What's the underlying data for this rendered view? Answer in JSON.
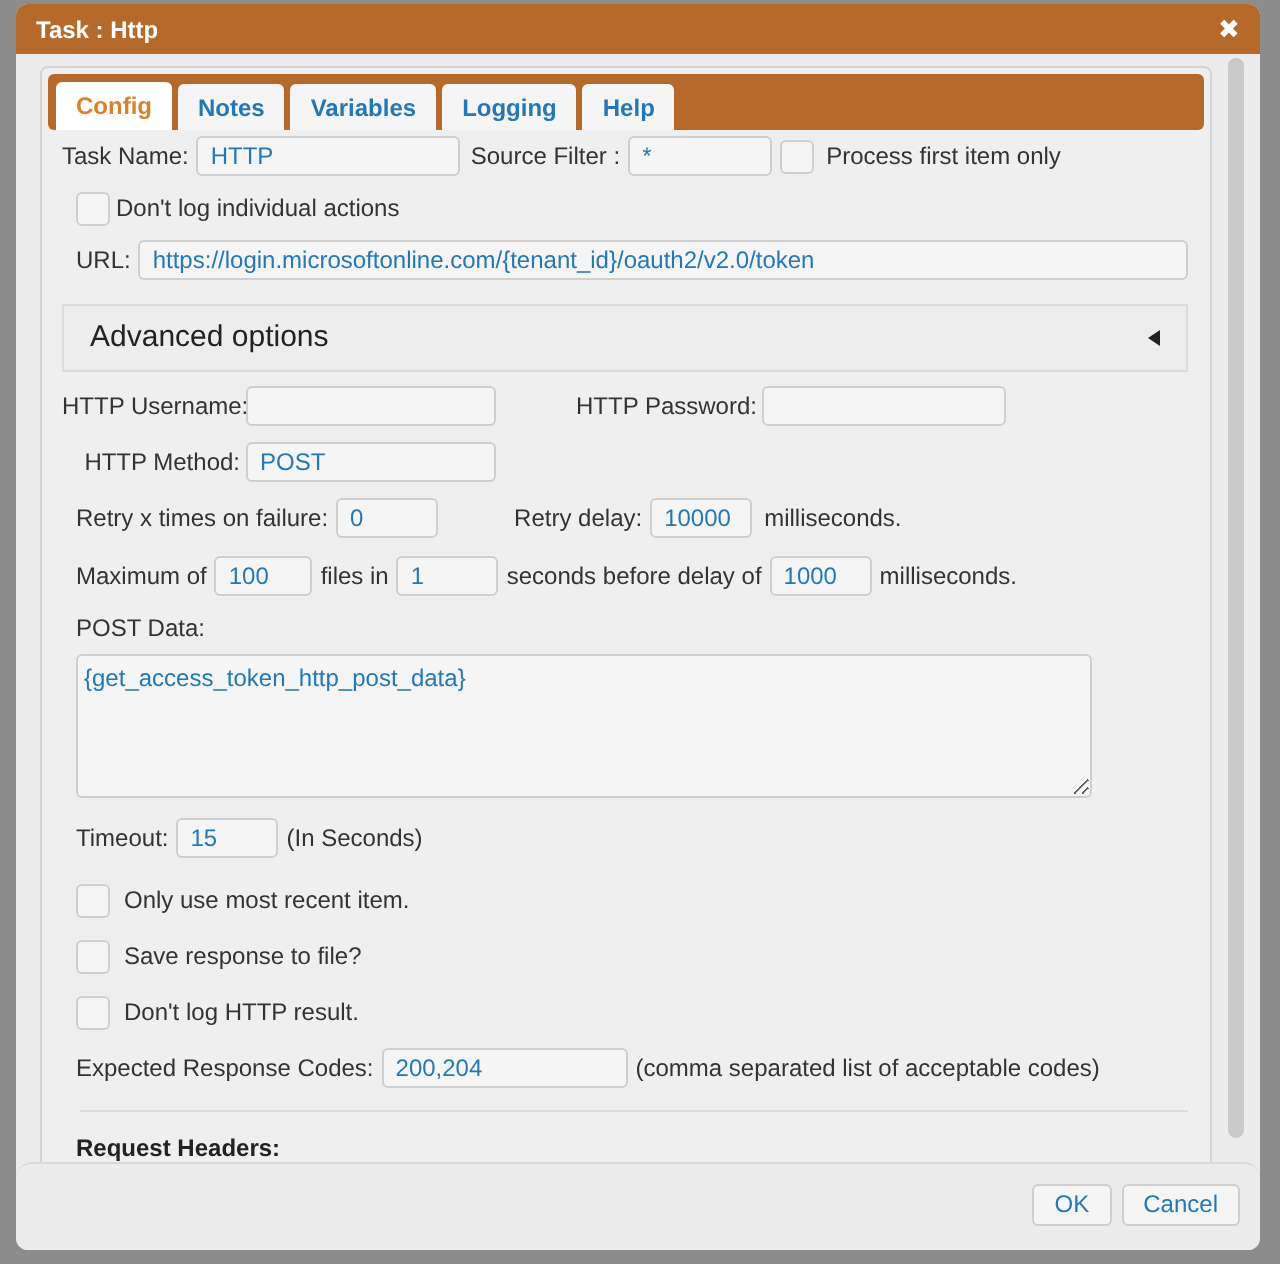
{
  "window": {
    "title": "Task : Http",
    "close_glyph": "✖"
  },
  "tabs": [
    {
      "label": "Config",
      "selected": true
    },
    {
      "label": "Notes",
      "selected": false
    },
    {
      "label": "Variables",
      "selected": false
    },
    {
      "label": "Logging",
      "selected": false
    },
    {
      "label": "Help",
      "selected": false
    }
  ],
  "task_name": {
    "label": "Task Name:",
    "value": "HTTP"
  },
  "source_filter": {
    "label": "Source Filter :",
    "value": "*"
  },
  "process_first_item_only": {
    "label": "Process first item only",
    "checked": false
  },
  "dont_log_individual_actions": {
    "label": "Don't log individual actions",
    "checked": false
  },
  "url": {
    "label": "URL:",
    "value": "https://login.microsoftonline.com/{tenant_id}/oauth2/v2.0/token"
  },
  "advanced_options": {
    "title": "Advanced options",
    "expanded": false
  },
  "http_username": {
    "label": "HTTP Username:"
  },
  "http_password": {
    "label": "HTTP Password:"
  },
  "http_method": {
    "label": "HTTP Method:",
    "value": "POST"
  },
  "retry_times": {
    "label": "Retry x times on failure:",
    "value": "0"
  },
  "retry_delay": {
    "label": "Retry delay:",
    "value": "10000",
    "unit": "milliseconds."
  },
  "throttle": {
    "label": "Maximum of",
    "files": "100",
    "files_label": "files in",
    "seconds": "1",
    "seconds_label": "seconds before delay of",
    "delay": "1000",
    "unit": "milliseconds."
  },
  "post_data": {
    "label": "POST Data:",
    "value": "{get_access_token_http_post_data}"
  },
  "timeout": {
    "label": "Timeout:",
    "value": "15",
    "unit": "(In Seconds)"
  },
  "options": [
    {
      "label": "Only use most recent item.",
      "checked": false
    },
    {
      "label": "Save response to file?",
      "checked": false
    },
    {
      "label": "Don't log HTTP result.",
      "checked": false
    }
  ],
  "expected_codes": {
    "label": "Expected Response Codes:",
    "value": "200,204",
    "hint": "(comma separated list of acceptable codes)"
  },
  "request_headers": {
    "title": "Request Headers:"
  },
  "buttons": [
    {
      "label": "OK"
    },
    {
      "label": "Cancel"
    }
  ]
}
